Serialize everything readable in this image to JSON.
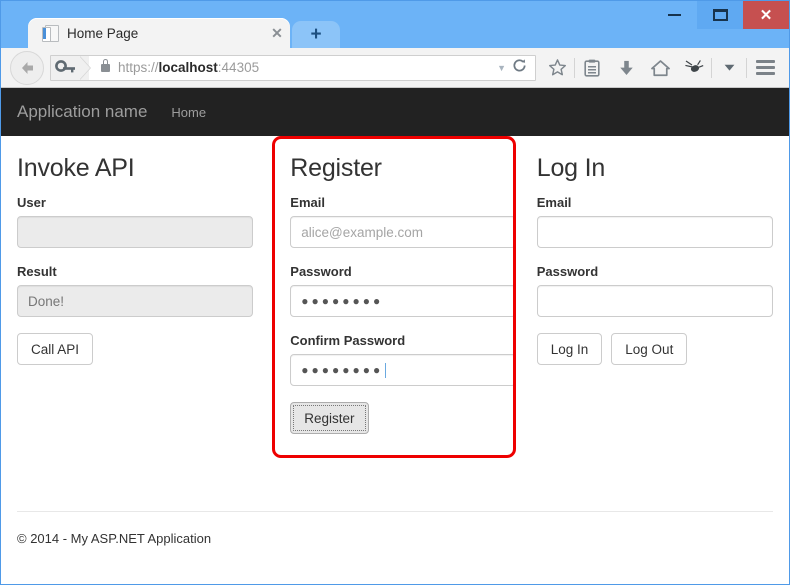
{
  "window": {
    "controls": {
      "minimize": "minimize",
      "maximize": "maximize",
      "close": "✕"
    }
  },
  "browser": {
    "tab": {
      "title": "Home Page",
      "close_label": "✕",
      "favicon": "page-icon"
    },
    "new_tab_label": "+",
    "back_label": "←",
    "identity_icon": "key-icon",
    "lock_icon": "lock-icon",
    "url": {
      "scheme": "https://",
      "host": "localhost",
      "port": ":44305",
      "dropdown": "▼",
      "reload": "↻"
    },
    "toolbar_icons": [
      {
        "name": "bookmark-star-icon",
        "glyph": "☆"
      },
      {
        "name": "reading-list-icon",
        "glyph": "ὌB"
      },
      {
        "name": "downloads-icon",
        "glyph": "⬇"
      },
      {
        "name": "home-icon",
        "glyph": "⌂"
      },
      {
        "name": "extension-icon",
        "glyph": "✿"
      },
      {
        "name": "overflow-chevron-icon",
        "glyph": "▾"
      }
    ],
    "menu_label": "menu"
  },
  "site": {
    "brand": "Application name",
    "nav_links": [
      "Home"
    ],
    "footer": "© 2014 - My ASP.NET Application"
  },
  "invoke_api": {
    "heading": "Invoke API",
    "user_label": "User",
    "user_value": "",
    "result_label": "Result",
    "result_value": "Done!",
    "call_button": "Call API"
  },
  "register": {
    "heading": "Register",
    "email_label": "Email",
    "email_placeholder": "alice@example.com",
    "password_label": "Password",
    "password_value": "●●●●●●●●",
    "confirm_label": "Confirm Password",
    "confirm_value": "●●●●●●●●",
    "submit_button": "Register",
    "highlight_color": "#ee0000"
  },
  "login": {
    "heading": "Log In",
    "email_label": "Email",
    "email_value": "",
    "password_label": "Password",
    "password_value": "",
    "login_button": "Log In",
    "logout_button": "Log Out"
  },
  "colors": {
    "titlebar": "#6cb3f7",
    "close_button": "#c65050",
    "navbar": "#222222",
    "highlight": "#ee0000"
  }
}
